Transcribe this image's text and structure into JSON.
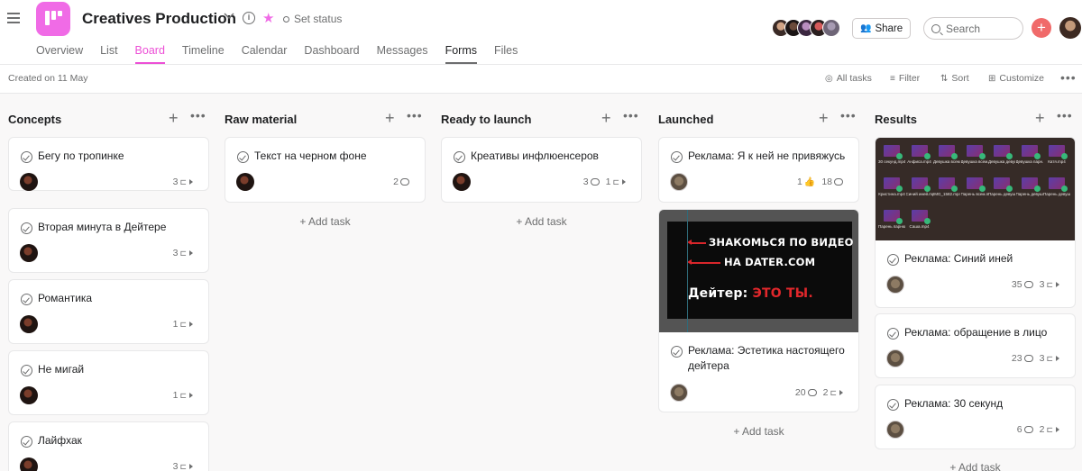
{
  "project": {
    "title": "Creatives Production",
    "status_label": "Set status",
    "accent": "#f06be6"
  },
  "tabs": [
    "Overview",
    "List",
    "Board",
    "Timeline",
    "Calendar",
    "Dashboard",
    "Messages",
    "Forms",
    "Files"
  ],
  "active_tab": "Board",
  "header": {
    "share_label": "Share",
    "search_placeholder": "Search"
  },
  "toolbar": {
    "created": "Created on 11 May",
    "all_tasks": "All tasks",
    "filter": "Filter",
    "sort": "Sort",
    "customize": "Customize"
  },
  "add_task_label": "+ Add task",
  "columns": [
    {
      "title": "Concepts",
      "cards": [
        {
          "title": "Бегу по тропинке",
          "subtasks": "3"
        },
        {
          "title": "Вторая минута в Дейтере",
          "subtasks": "3"
        },
        {
          "title": "Романтика",
          "subtasks": "1"
        },
        {
          "title": "Не мигай",
          "subtasks": "1"
        },
        {
          "title": "Лайфхак",
          "subtasks": "3"
        }
      ]
    },
    {
      "title": "Raw material",
      "cards": [
        {
          "title": "Текст на черном фоне",
          "comments": "2"
        }
      ]
    },
    {
      "title": "Ready to launch",
      "cards": [
        {
          "title": "Креативы инфлюенсеров",
          "comments": "3",
          "subtasks": "1"
        }
      ]
    },
    {
      "title": "Launched",
      "cards": [
        {
          "title": "Реклама: Я к ней не привяжусь",
          "likes": "1",
          "comments": "18"
        },
        {
          "title": "Реклама: Эстетика настоящего дейтера",
          "comments": "20",
          "subtasks": "2",
          "cover": {
            "line1": "ЗНАКОМЬСЯ ПО ВИДЕО",
            "line2": "НА DATER.COM",
            "line3_white": "Дейтер: ",
            "line3_red": "ЭТО ТЫ."
          }
        }
      ]
    },
    {
      "title": "Results",
      "cards": [
        {
          "title": "Реклама: Синий иней",
          "comments": "35",
          "subtasks": "3",
          "files": [
            "30 секунд.mp4",
            "Анфиса.mp4",
            "Девушка всем 2.mp4",
            "Девушка всем.mp4",
            "Девушка девушк...2.mp4",
            "Девушка парн...д4.mp4",
            "Катя.mp4",
            "Кристина.mp4",
            "Синий иней.mp4",
            "IMG_1582.mp4",
            "Парень всем.mp4",
            "Парень девушк...2.mp4",
            "Парень девушке.mp4",
            "Парень девушк...4.mp4",
            "Парень парню.mp4",
            "Саша.mp4"
          ]
        },
        {
          "title": "Реклама: обращение в лицо",
          "comments": "23",
          "subtasks": "3"
        },
        {
          "title": "Реклама: 30 секунд",
          "comments": "6",
          "subtasks": "2"
        }
      ]
    }
  ],
  "icons": {
    "menu": "hamburger-icon",
    "info": "info-icon",
    "star": "star-icon",
    "search": "search-icon",
    "add": "plus-icon",
    "comment": "comment-icon",
    "subtask": "subtask-icon",
    "like": "thumbs-up-icon"
  },
  "colors": {
    "active_tab": "#ec4fd6",
    "add_button": "#f06a6a",
    "board_bg": "#f9f8f8"
  }
}
